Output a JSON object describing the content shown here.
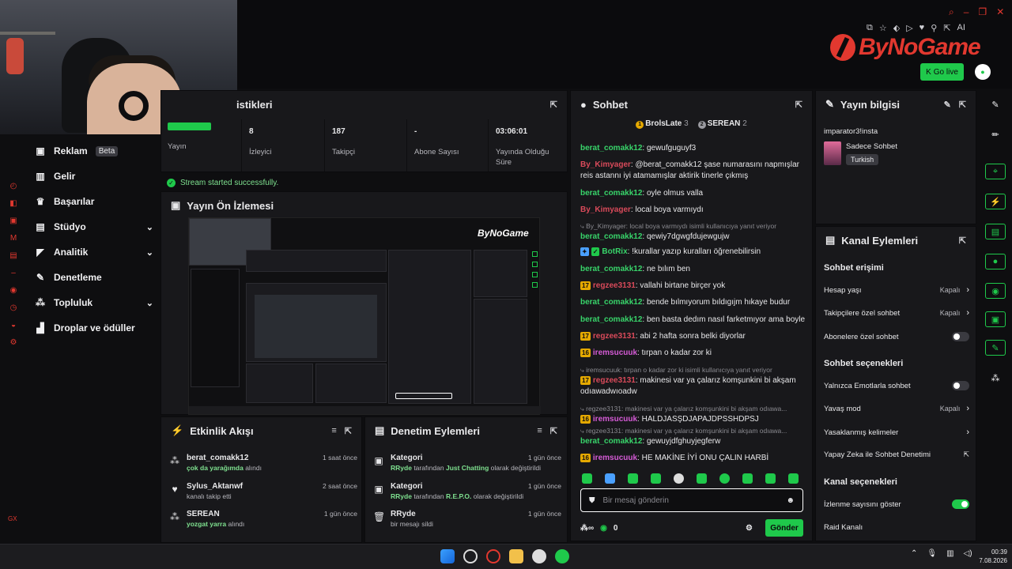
{
  "header": {
    "logo_text": "ByNoGame",
    "go_live_label": "Go live",
    "extension_icons": [
      "translate-icon",
      "bookmark-icon",
      "tag-icon",
      "play-icon",
      "heart-icon",
      "pin-icon",
      "share-icon",
      "AI"
    ],
    "window_controls": [
      "search-icon",
      "minimize-icon",
      "restore-icon",
      "close-icon"
    ]
  },
  "sidebar": {
    "items": [
      {
        "label": "Reklam",
        "badge": "Beta",
        "icon": "ad-icon"
      },
      {
        "label": "Gelir",
        "icon": "chart-icon"
      },
      {
        "label": "Başarılar",
        "icon": "trophy-icon"
      },
      {
        "label": "Stüdyo",
        "icon": "studio-icon",
        "expandable": true
      },
      {
        "label": "Analitik",
        "icon": "analytics-icon",
        "expandable": true
      },
      {
        "label": "Denetleme",
        "icon": "wrench-icon"
      },
      {
        "label": "Topluluk",
        "icon": "community-icon",
        "expandable": true
      },
      {
        "label": "Droplar ve ödüller",
        "icon": "drops-icon"
      }
    ],
    "bottom_text": "GX"
  },
  "stats": {
    "title": "istikleri",
    "items": [
      {
        "value": "",
        "label": "Yayın"
      },
      {
        "value": "8",
        "label": "İzleyici"
      },
      {
        "value": "187",
        "label": "Takipçi"
      },
      {
        "value": "-",
        "label": "Abone Sayısı"
      },
      {
        "value": "03:06:01",
        "label": "Yayında Olduğu Süre"
      }
    ],
    "success_message": "Stream started successfully."
  },
  "preview": {
    "title": "Yayın Ön İzlemesi"
  },
  "activity": {
    "title": "Etkinlik Akışı",
    "items": [
      {
        "user": "berat_comakk12",
        "detail_highlight": "çok da yarağımda",
        "detail": "alındı",
        "time": "1 saat önce"
      },
      {
        "user": "Sylus_Aktanwf",
        "detail_highlight": "",
        "detail": "kanalı takip etti",
        "time": "2 saat önce"
      },
      {
        "user": "SEREAN",
        "detail_highlight": "yozgat yarra",
        "detail": "alındı",
        "time": "1 gün önce"
      }
    ]
  },
  "modlog": {
    "title": "Denetim Eylemleri",
    "items": [
      {
        "title": "Kategori",
        "actor": "RRyde",
        "middle": "tarafından",
        "highlight": "Just Chatting",
        "detail": "olarak değiştirildi",
        "time": "1 gün önce"
      },
      {
        "title": "Kategori",
        "actor": "RRyde",
        "middle": "tarafından",
        "highlight": "R.E.P.O.",
        "detail": "olarak değiştirildi",
        "time": "1 gün önce"
      },
      {
        "title": "RRyde",
        "actor": "",
        "middle": "",
        "highlight": "",
        "detail": "bir mesajı sildi",
        "time": "1 gün önce"
      }
    ]
  },
  "chat": {
    "title": "Sohbet",
    "top_users": [
      {
        "rank": "1",
        "name": "BrolsLate",
        "count": "3"
      },
      {
        "rank": "2",
        "name": "SEREAN",
        "count": "2"
      }
    ],
    "messages": [
      {
        "lvl": "",
        "user": "berat_comakk12",
        "color": "g",
        "text": "gewufguguyf3"
      },
      {
        "lvl": "",
        "user": "By_Kimyager",
        "color": "r",
        "text": "@berat_comakk12 şase numarasını napmışlar reis astannı iyi atamamışlar aktirik tinerle çıkmış"
      },
      {
        "lvl": "",
        "user": "berat_comakk12",
        "color": "g",
        "text": "oyle olmus valla"
      },
      {
        "lvl": "",
        "user": "By_Kimyager",
        "color": "r",
        "text": "local boya varmıydı"
      },
      {
        "reply": "By_Kimyager: local boya varmıydı isimli kullanıcıya yanıt veriyor",
        "lvl": "",
        "user": "berat_comakk12",
        "color": "g",
        "text": "qewiy7dgwgfdujewgujw"
      },
      {
        "lvl": "",
        "user": "BotRix",
        "color": "g",
        "text": "!kurallar yazıp kuralları öğrenebilirsin"
      },
      {
        "lvl": "",
        "user": "berat_comakk12",
        "color": "g",
        "text": "ne bılım ben"
      },
      {
        "lvl": "17",
        "user": "regzee3131",
        "color": "r",
        "text": "vallahi birtane birçer yok"
      },
      {
        "lvl": "",
        "user": "berat_comakk12",
        "color": "g",
        "text": "bende bılmıyorum bıldıgıjm hıkaye budur"
      },
      {
        "lvl": "",
        "user": "berat_comakk12",
        "color": "g",
        "text": "ben basta dedım nasıl farketmıyor ama boyle"
      },
      {
        "lvl": "17",
        "user": "regzee3131",
        "color": "r",
        "text": "abi 2 hafta sonra belki diyorlar"
      },
      {
        "lvl": "16",
        "user": "iremsucuuk",
        "color": "p",
        "text": "tırpan o kadar zor ki"
      },
      {
        "reply": "iremsucuuk: tırpan o kadar zor ki isimli kullanıcıya yanıt veriyor",
        "lvl": "17",
        "user": "regzee3131",
        "color": "r",
        "text": "makinesi var ya çalarız komşunkini bi akşam odıawadwıoadw"
      },
      {
        "reply": "regzee3131: makinesi var ya çalarız komşunkini bi akşam odıawa...",
        "lvl": "16",
        "user": "iremsucuuk",
        "color": "p",
        "text": "HALDJASŞDJAPAJDPSSHDPSJ"
      },
      {
        "reply": "regzee3131: makinesi var ya çalarız komşunkini bi akşam odıawa...",
        "lvl": "",
        "user": "berat_comakk12",
        "color": "g",
        "text": "gewuyjdfghuyjegferw"
      },
      {
        "lvl": "16",
        "user": "iremsucuuk",
        "color": "p",
        "text": "HE MAKİNE İYİ ONU ÇALIN HARBİ"
      }
    ],
    "input_placeholder": "Bir mesaj gönderin",
    "footer_count": "0",
    "send_label": "Gönder"
  },
  "stream_info": {
    "title": "Yayın bilgisi",
    "stream_title": "imparator3!insta",
    "category": "Sadece Sohbet",
    "language": "Turkish"
  },
  "channel_actions": {
    "title": "Kanal Eylemleri",
    "sections": [
      {
        "heading": "Sohbet erişimi"
      },
      {
        "heading": "Sohbet seçenekleri"
      },
      {
        "heading": "Kanal seçenekleri"
      }
    ],
    "rows": {
      "hesap_yasi": {
        "label": "Hesap yaşı",
        "value": "Kapalı"
      },
      "takipci": {
        "label": "Takipçilere özel sohbet",
        "value": "Kapalı"
      },
      "abone": {
        "label": "Abonelere özel sohbet",
        "toggle": false
      },
      "emote": {
        "label": "Yalnızca Emotlarla sohbet",
        "toggle": false
      },
      "yavas": {
        "label": "Yavaş mod",
        "value": "Kapalı"
      },
      "yasak": {
        "label": "Yasaklanmış kelimeler"
      },
      "ai": {
        "label": "Yapay Zeka ile Sohbet Denetimi"
      },
      "izlenme": {
        "label": "İzlenme sayısını göster",
        "toggle": true
      },
      "raid": {
        "label": "Raid Kanalı"
      }
    }
  },
  "taskbar": {
    "clock_time": "00:39",
    "clock_date": "7.08.2026"
  },
  "colors": {
    "accent": "#1fc94b",
    "brand": "#e2382f",
    "panel": "#18181b"
  }
}
